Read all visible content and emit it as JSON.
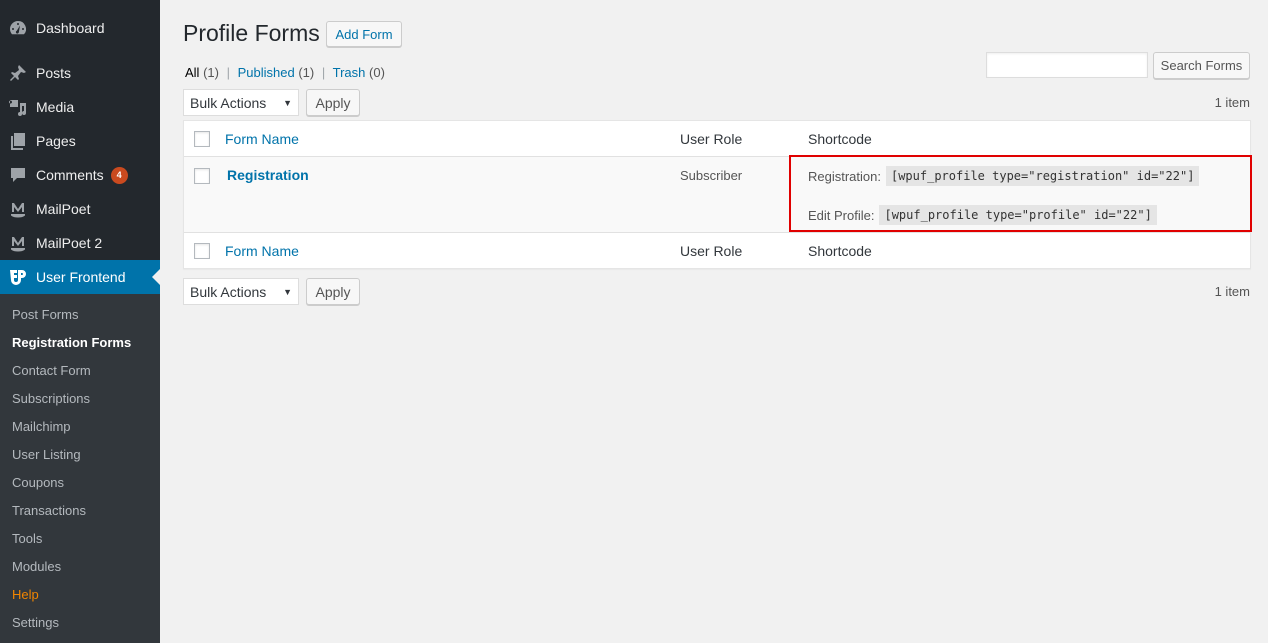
{
  "sidebar": {
    "items": [
      {
        "label": "Dashboard",
        "icon": "dashboard-icon"
      },
      {
        "label": "Posts",
        "icon": "pin-icon"
      },
      {
        "label": "Media",
        "icon": "media-icon"
      },
      {
        "label": "Pages",
        "icon": "pages-icon"
      },
      {
        "label": "Comments",
        "icon": "comment-icon",
        "badge": "4"
      },
      {
        "label": "MailPoet",
        "icon": "mailpoet-icon"
      },
      {
        "label": "MailPoet 2",
        "icon": "mailpoet-icon"
      },
      {
        "label": "User Frontend",
        "icon": "user-frontend-icon",
        "active": true
      }
    ],
    "submenu": [
      "Post Forms",
      "Registration Forms",
      "Contact Form",
      "Subscriptions",
      "Mailchimp",
      "User Listing",
      "Coupons",
      "Transactions",
      "Tools",
      "Modules",
      "Help",
      "Settings"
    ],
    "current_submenu": "Registration Forms",
    "colors": {
      "bg": "#23282d",
      "submenu_bg": "#32373c",
      "active": "#0073aa",
      "help": "#f18500",
      "badge": "#ca4a1f"
    }
  },
  "page": {
    "title": "Profile Forms",
    "add_button": "Add Form",
    "filters": {
      "all_label": "All",
      "all_count": "(1)",
      "published_label": "Published",
      "published_count": "(1)",
      "trash_label": "Trash",
      "trash_count": "(0)",
      "separator": "|"
    },
    "search": {
      "placeholder": "",
      "value": "",
      "button": "Search Forms"
    },
    "bulk": {
      "selected": "Bulk Actions",
      "apply": "Apply"
    },
    "item_count": "1 item"
  },
  "table": {
    "columns": [
      "Form Name",
      "User Role",
      "Shortcode"
    ],
    "rows": [
      {
        "name": "Registration",
        "role": "Subscriber",
        "shortcodes": [
          {
            "label": "Registration:",
            "code": "[wpuf_profile type=\"registration\" id=\"22\"]"
          },
          {
            "label": "Edit Profile:",
            "code": "[wpuf_profile type=\"profile\" id=\"22\"]"
          }
        ]
      }
    ],
    "highlight_color": "#e00000"
  }
}
